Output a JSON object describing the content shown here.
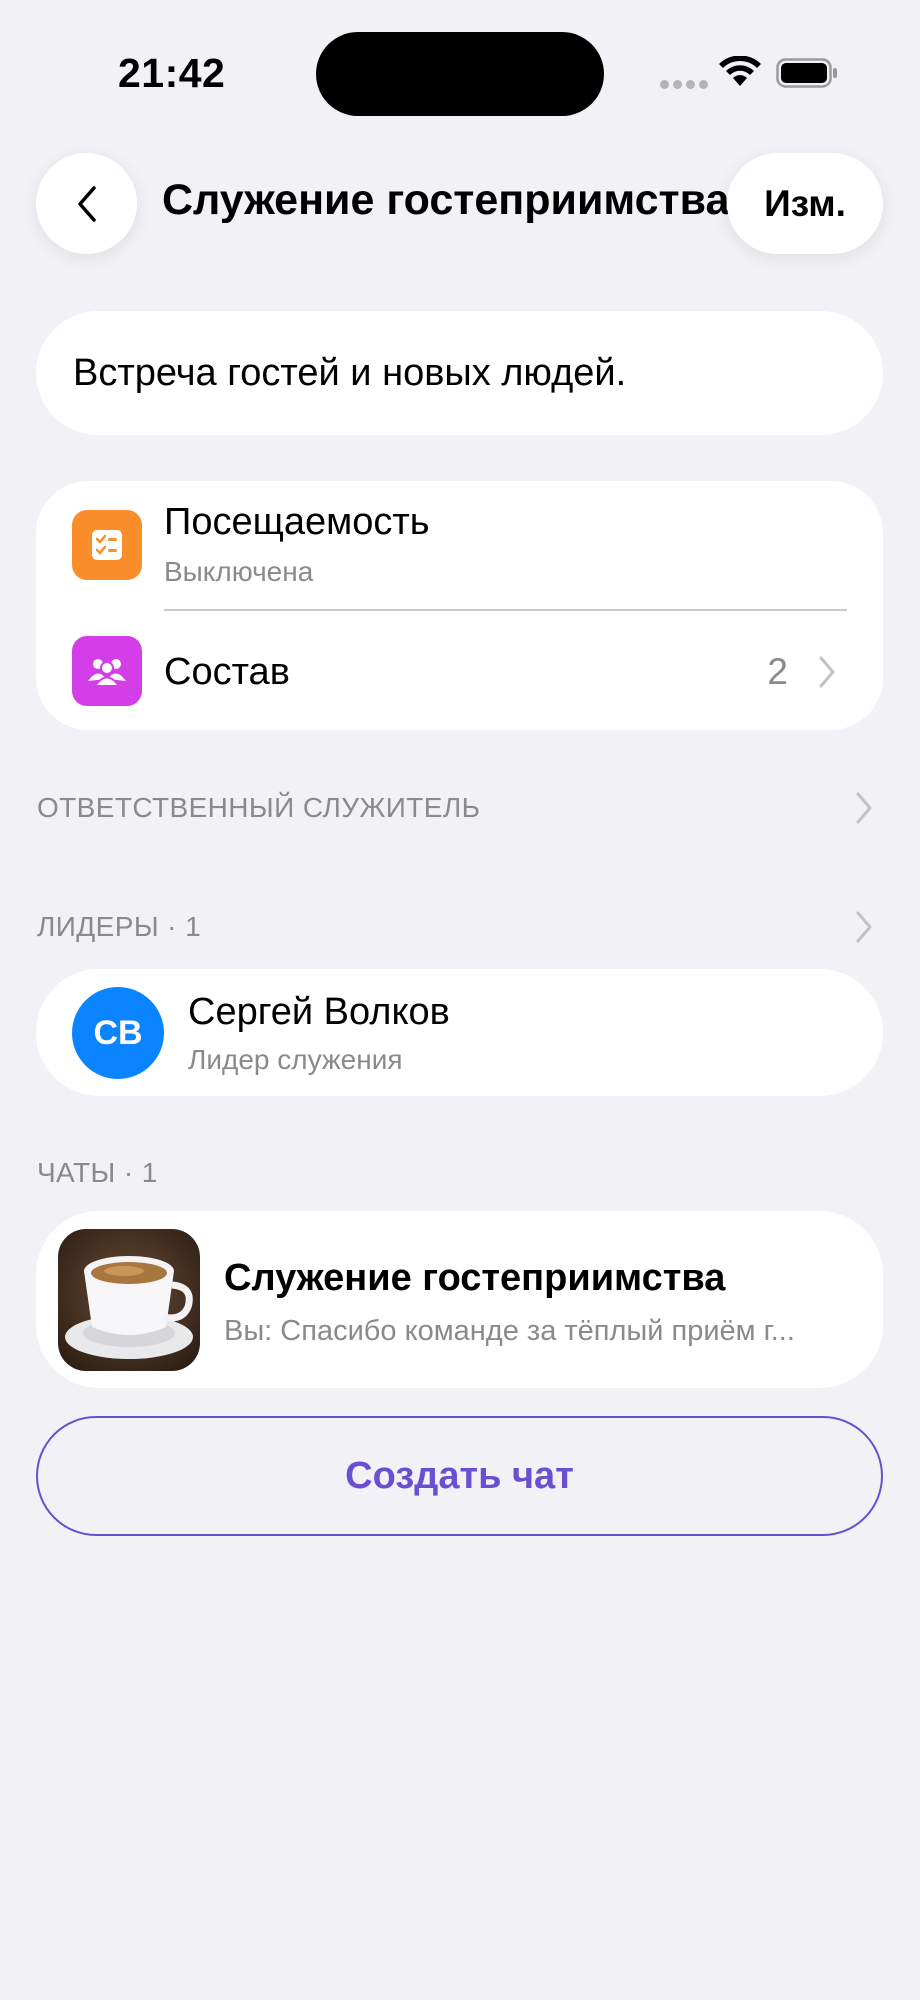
{
  "status_bar": {
    "time": "21:42"
  },
  "header": {
    "title": "Служение гостеприимства",
    "edit_label": "Изм."
  },
  "description": "Встреча гостей и новых людей.",
  "menu": {
    "attendance": {
      "title": "Посещаемость",
      "subtitle": "Выключена"
    },
    "members": {
      "title": "Состав",
      "count": "2"
    }
  },
  "responsible": {
    "header": "ОТВЕТСТВЕННЫЙ СЛУЖИТЕЛЬ"
  },
  "leaders": {
    "header": "ЛИДЕРЫ · 1",
    "items": [
      {
        "initials": "СВ",
        "name": "Сергей Волков",
        "role": "Лидер служения"
      }
    ]
  },
  "chats": {
    "header": "ЧАТЫ · 1",
    "items": [
      {
        "title": "Служение гостеприимства",
        "preview": "Вы: Спасибо команде за тёплый приём г..."
      }
    ]
  },
  "create_chat_label": "Создать чат",
  "colors": {
    "background": "#f1f1f6",
    "attendance_icon": "#fa8e2a",
    "members_icon": "#d33ee8",
    "avatar": "#0a84ff",
    "accent": "#6a4fd3"
  },
  "icons": {
    "back": "chevron-left-icon",
    "attendance": "checklist-icon",
    "members": "people-icon",
    "disclosure": "chevron-right-icon"
  }
}
